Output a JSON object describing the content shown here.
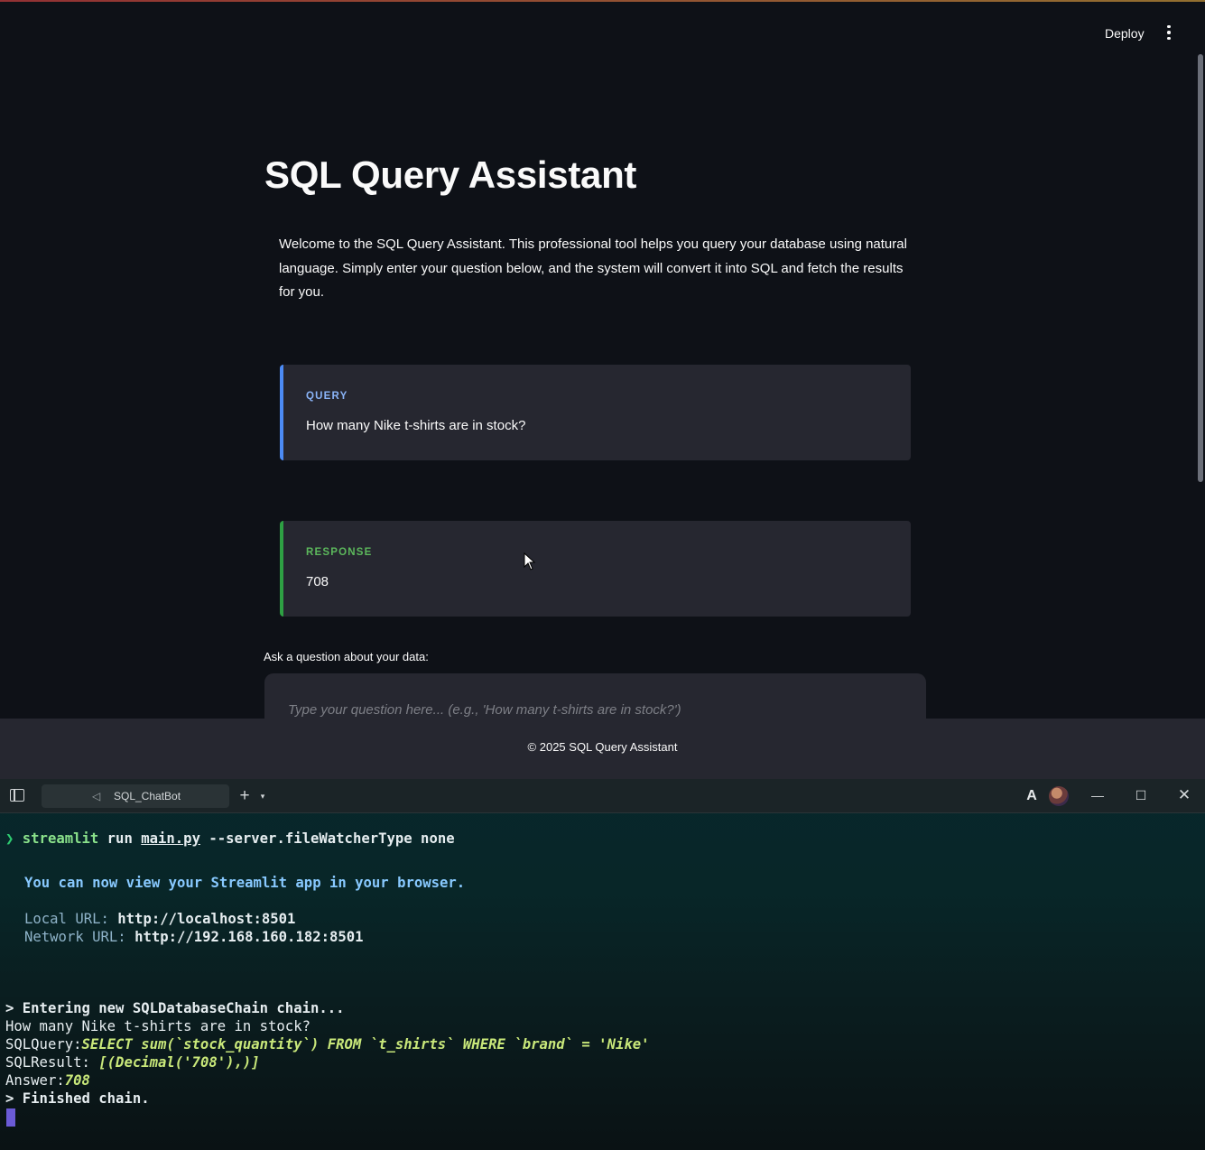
{
  "app": {
    "deploy_label": "Deploy",
    "title": "SQL Query Assistant",
    "intro": "Welcome to the SQL Query Assistant. This professional tool helps you query your database using natural language. Simply enter your question below, and the system will convert it into SQL and fetch the results for you.",
    "query_card": {
      "label": "QUERY",
      "text": "How many Nike t-shirts are in stock?"
    },
    "response_card": {
      "label": "RESPONSE",
      "text": "708"
    },
    "ask_label": "Ask a question about your data:",
    "input": {
      "value": "",
      "placeholder": "Type your question here... (e.g., 'How many t-shirts are in stock?')"
    },
    "footer": "© 2025 SQL Query Assistant"
  },
  "terminal": {
    "tab_label": "SQL_ChatBot",
    "lines": {
      "prompt_symbol": "❯",
      "cmd_streamlit": "streamlit",
      "cmd_run": "run",
      "cmd_file": "main.py",
      "cmd_args": "--server.fileWatcherType none",
      "view_msg": "You can now view your Streamlit app in your browser.",
      "local_label": "Local URL:",
      "local_url": "http://localhost:8501",
      "network_label": "Network URL:",
      "network_url": "http://192.168.160.182:8501",
      "entering": "> Entering new SQLDatabaseChain chain...",
      "question": "How many Nike t-shirts are in stock?",
      "sqlquery_label": "SQLQuery:",
      "sqlquery": "SELECT sum(`stock_quantity`) FROM `t_shirts` WHERE `brand` = 'Nike'",
      "sqlresult_label": "SQLResult:",
      "sqlresult": "[(Decimal('708'),)]",
      "answer_label": "Answer:",
      "answer": "708",
      "finished": "> Finished chain."
    }
  },
  "colors": {
    "app_bg": "#0e1117",
    "card_bg": "#262730",
    "query_accent": "#4c8bf5",
    "response_accent": "#2ea043",
    "terminal_bg": "#07272b"
  },
  "icons": [
    "menu-icon",
    "sidebar-toggle-icon",
    "terminal-tab-icon",
    "plus-icon",
    "chevron-down-icon",
    "font-icon",
    "avatar",
    "minimize-icon",
    "maximize-icon",
    "close-icon"
  ]
}
